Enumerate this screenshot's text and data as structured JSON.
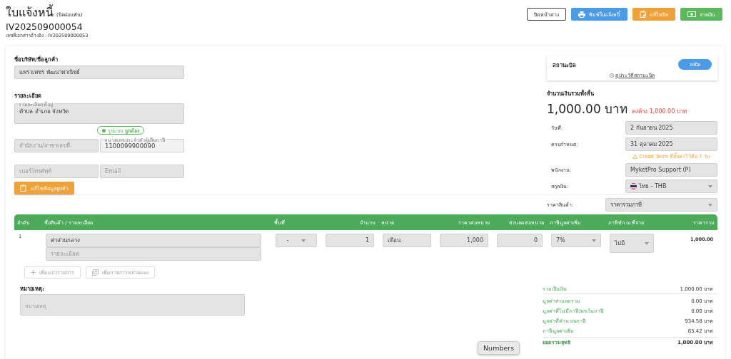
{
  "header": {
    "title": "ใบแจ้งหนี้",
    "subtitle": "(บิลผ่อนพัน)",
    "doc_no": "IV202509000054",
    "ref": "เลขที่เอกสารอ้างอิง : IV202509000053",
    "buttons": [
      {
        "label": "ปิดหน้าต่าง",
        "kind": "close"
      },
      {
        "label": "พิมพ์ใบแจ้งหนี้",
        "kind": "print"
      },
      {
        "label": "แก้ไขบิล",
        "kind": "edit"
      },
      {
        "label": "จ่ายเงิน",
        "kind": "pay"
      }
    ]
  },
  "customer": {
    "name_label": "ชื่อบริษัท/ชื่อลูกค้า",
    "name": "แพรวเพชร พัฒนาพาณิชย์",
    "detail_label": "รายละเอียด",
    "address_label": "รายละเอียดที่อยู่",
    "address": "ตำบล อำเภอ จังหวัด",
    "tax_badge": "รูปแบบ **ถูกต้อง**",
    "branch_placeholder": "สำนักงาน/สาขาเลขที่",
    "tax_label": "หมายเลขประจำตัวผู้เสียภาษี",
    "tax_id": "1100099900090",
    "phone_placeholder": "เบอร์โทรศัพท์",
    "email_placeholder": "Email",
    "edit_button": "แก้ไขข้อมูลลูกค้า"
  },
  "status": {
    "label": "สถานะบิล",
    "value": "ส่งบิล",
    "history_link": "ดูประวัติสถานะบิล"
  },
  "total": {
    "label": "จำนวนเงินรวมทั้งสิ้น",
    "amount": "1,000.00 บาท",
    "outstanding": "คงค้าง 1,000.00 บาท"
  },
  "fields": [
    {
      "label": "วันที่:",
      "value": "2 กันยายน 2025",
      "kind": "text"
    },
    {
      "label": "ครบกำหนด:",
      "value": "31 ตุลาคม 2025",
      "kind": "text",
      "warning": "Credit Term ที่ตั้งค่าไว้คือ 7 วัน"
    },
    {
      "label": "พนักงาน:",
      "value": "MyketPro Support (P)",
      "kind": "text"
    },
    {
      "label": "สกุลเงิน:",
      "value": "ไทย - THB",
      "kind": "currency"
    }
  ],
  "price_type": {
    "label": "ราคาสินค้า:",
    "value": "ราคารวมภาษี"
  },
  "table": {
    "columns": [
      "ลำดับ",
      "ชื่อสินค้า / รายละเอียด",
      "พื้นที่",
      "จำนวน",
      "หน่วย",
      "ราคาต่อหน่วย",
      "ส่วนลดต่อหน่วย",
      "ภาษีมูลค่าเพิ่ม",
      "ภาษีหัก ณ ที่จ่าย",
      "ราคารวม"
    ],
    "rows": [
      {
        "index": "1",
        "name": "ค่าส่วนกลาง",
        "detail_placeholder": "รายละเอียด",
        "area": "-",
        "qty": "1",
        "unit": "เดือน",
        "unit_price": "1,000",
        "discount": "0",
        "vat": "7%",
        "wht": "ไม่มี",
        "total": "1,000.00"
      }
    ],
    "add_buttons": [
      {
        "label": "เพิ่มแถวรายการ",
        "kind": "row"
      },
      {
        "label": "เพิ่มรายการหลายแผง",
        "kind": "multi"
      }
    ]
  },
  "note": {
    "label": "หมายเหตุ:",
    "placeholder": "หมายเหตุ"
  },
  "summary": [
    {
      "label": "รวมเป็นเงิน",
      "value": "1,000.00 บาท",
      "kind": "subtotal"
    },
    {
      "label": "มูลค่าส่วนลดรวม",
      "value": "0.00 บาท",
      "kind": "line"
    },
    {
      "label": "มูลค่าที่ไม่มีภาษี/ยกเว้นภาษี",
      "value": "0.00 บาท",
      "kind": "line"
    },
    {
      "label": "มูลค่าที่คำนวณภาษี",
      "value": "934.58 บาท",
      "kind": "line"
    },
    {
      "label": "ภาษีมูลค่าเพิ่ม",
      "value": "65.42 บาท",
      "kind": "line"
    },
    {
      "label": "ยอดรวมสุทธิ",
      "value": "1,000.00 บาท",
      "kind": "grand"
    }
  ],
  "tooltip": {
    "label": "Numbers"
  }
}
